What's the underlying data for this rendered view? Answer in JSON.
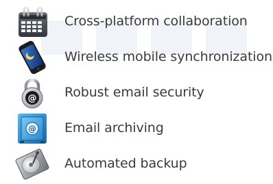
{
  "features": [
    {
      "label": "Cross-platform collaboration",
      "icon": "calendar-icon"
    },
    {
      "label": "Wireless mobile synchronization",
      "icon": "smartphone-icon"
    },
    {
      "label": "Robust email security",
      "icon": "padlock-at-icon"
    },
    {
      "label": "Email archiving",
      "icon": "safe-at-icon"
    },
    {
      "label": "Automated backup",
      "icon": "hard-drive-icon"
    }
  ],
  "colors": {
    "text": "#3a3a3a",
    "calendar_bg": "#4a4f56",
    "phone_screen": "#1f5aa6",
    "safe_blue": "#2b8fd0",
    "drive_grey": "#8a8d91"
  }
}
